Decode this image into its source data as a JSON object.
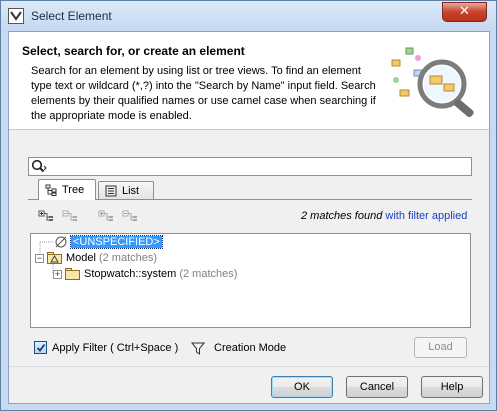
{
  "window": {
    "title": "Select Element",
    "close_label": "✕"
  },
  "header": {
    "title": "Select, search for, or create an element",
    "description": "Search for an element by using list or tree views. To find an element type text or wildcard (*,?) into the \"Search by Name\" input field. Search elements by their qualified names or use camel case when searching if the appropriate mode is enabled."
  },
  "search": {
    "value": "",
    "placeholder": ""
  },
  "tabs": [
    {
      "label": "Tree",
      "icon": "tree-icon",
      "active": true
    },
    {
      "label": "List",
      "icon": "list-icon",
      "active": false
    }
  ],
  "toolbar": {
    "buttons": [
      "expand-all-icon",
      "collapse-all-icon",
      "expand-selected-icon",
      "collapse-selected-icon"
    ]
  },
  "matches": {
    "text": "2 matches found",
    "filter_text": "with filter applied"
  },
  "tree": {
    "items": [
      {
        "label": "<UNSPECIFIED>",
        "icon": "null-icon",
        "selected": true
      },
      {
        "label": "Model",
        "count": "(2 matches)",
        "icon": "model-icon",
        "expander": "−"
      },
      {
        "label": "Stopwatch::system",
        "count": "(2 matches)",
        "icon": "package-icon",
        "expander": "+"
      }
    ]
  },
  "options": {
    "apply_filter_label": "Apply Filter ( Ctrl+Space )",
    "apply_filter_checked": true,
    "creation_mode_label": "Creation Mode",
    "load_label": "Load"
  },
  "buttons": {
    "ok": "OK",
    "cancel": "Cancel",
    "help": "Help"
  },
  "colors": {
    "selection": "#3399ff",
    "link": "#1a40c8",
    "close": "#c7432b"
  }
}
